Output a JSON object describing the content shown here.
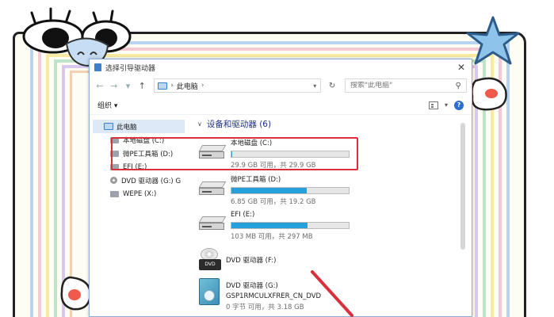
{
  "window": {
    "title": "选择引导驱动器",
    "close_glyph": "✕"
  },
  "address": {
    "back": "←",
    "forward": "→",
    "dropdown": "▾",
    "up": "↑",
    "path": "此电脑",
    "separator": "›",
    "search_placeholder": "搜索\"此电脑\""
  },
  "toolbar": {
    "organize": "组织 ▾",
    "view_dropdown": "▾",
    "help": "?"
  },
  "nav": {
    "root": "此电脑",
    "items": [
      {
        "label": "本地磁盘 (C:)",
        "icon": "drive-icon"
      },
      {
        "label": "微PE工具箱 (D:)",
        "icon": "drive-icon"
      },
      {
        "label": "EFI (E:)",
        "icon": "drive-icon"
      },
      {
        "label": "DVD 驱动器 (G:) G",
        "icon": "dvd-icon"
      },
      {
        "label": "WEPE (X:)",
        "icon": "drive-icon"
      }
    ]
  },
  "group": {
    "chevron": "∨",
    "title": "设备和驱动器 (6)"
  },
  "drives": [
    {
      "name": "本地磁盘 (C:)",
      "stat": "29.9 GB 可用，共 29.9 GB",
      "used": 0.01
    },
    {
      "name": "微PE工具箱 (D:)",
      "stat": "6.85 GB 可用，共 19.2 GB",
      "used": 0.64
    },
    {
      "name": "EFI (E:)",
      "stat": "103 MB 可用，共 297 MB",
      "used": 0.65
    },
    {
      "name": "DVD 驱动器 (F:)"
    },
    {
      "name": "DVD 驱动器 (G:)",
      "label2": "GSP1RMCULXFRER_CN_DVD",
      "stat": "0 字节 可用，共 3.18 GB"
    }
  ],
  "dvd_logo": "DVD",
  "colors": {
    "highlight": "#d9303b",
    "usage_bar": "#26a0da",
    "group_title": "#1e3287"
  }
}
